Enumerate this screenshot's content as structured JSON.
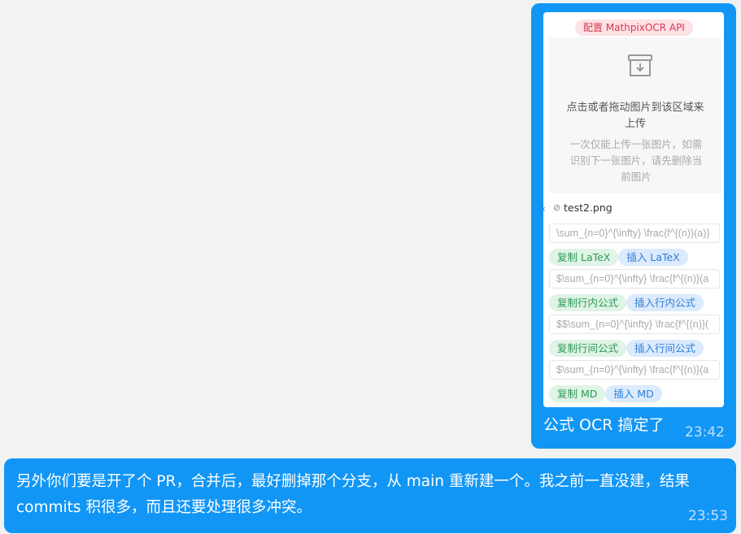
{
  "message1": {
    "config_label": "配置 MathpixOCR API",
    "upload": {
      "icon": "download-box-icon",
      "title": "点击或者拖动图片到该区域来上传",
      "hint": "一次仅能上传一张图片，如需识别下一张图片，请先删除当前图片"
    },
    "file": {
      "name": "test2.png",
      "collapse_icon": "chevron-left-icon",
      "attach_icon": "paperclip-icon"
    },
    "results": [
      {
        "value": "\\sum_{n=0}^{\\infty} \\frac{f^{(n)}(a)}",
        "copy_label": "复制 LaTeX",
        "insert_label": "插入 LaTeX"
      },
      {
        "value": "$\\sum_{n=0}^{\\infty} \\frac{f^{(n)}(a",
        "copy_label": "复制行内公式",
        "insert_label": "插入行内公式"
      },
      {
        "value": "$$\\sum_{n=0}^{\\infty} \\frac{f^{(n)}(",
        "copy_label": "复制行间公式",
        "insert_label": "插入行间公式"
      },
      {
        "value": "$\\sum_{n=0}^{\\infty} \\frac{f^{(n)}(a",
        "copy_label": "复制 MD",
        "insert_label": "插入 MD"
      }
    ],
    "caption": "公式 OCR 搞定了",
    "time": "23:42"
  },
  "message2": {
    "text": "另外你们要是开了个 PR，合并后，最好删掉那个分支，从 main 重新建一个。我之前一直没建，结果 commits 积很多，而且还要处理很多冲突。",
    "time": "23:53"
  },
  "colors": {
    "bubble": "#1296f5",
    "background": "#f2f2f2",
    "config_tag": "#fde2e6",
    "copy_pill": "#dff3e6",
    "insert_pill": "#dbeafc"
  }
}
